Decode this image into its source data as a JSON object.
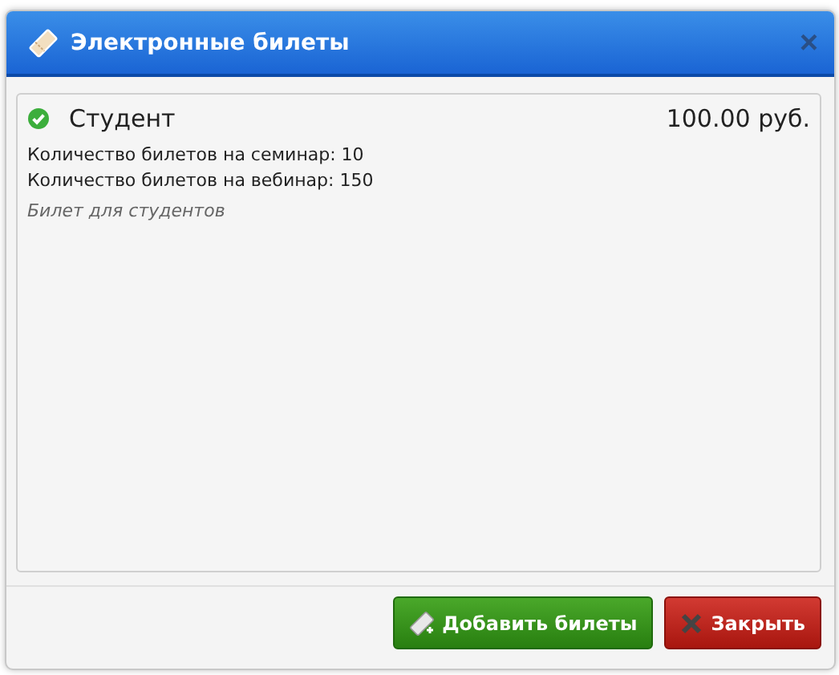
{
  "dialog": {
    "title": "Электронные билеты",
    "close": "×"
  },
  "tickets": [
    {
      "name": "Студент",
      "selected": true,
      "price": "100.00 руб.",
      "lines": [
        "Количество билетов на семинар: 10",
        "Количество билетов на вебинар: 150"
      ],
      "description": "Билет для студентов"
    }
  ],
  "buttons": [
    {
      "kind": "add",
      "label": "Добавить билеты"
    },
    {
      "kind": "close",
      "label": "Закрыть"
    }
  ]
}
